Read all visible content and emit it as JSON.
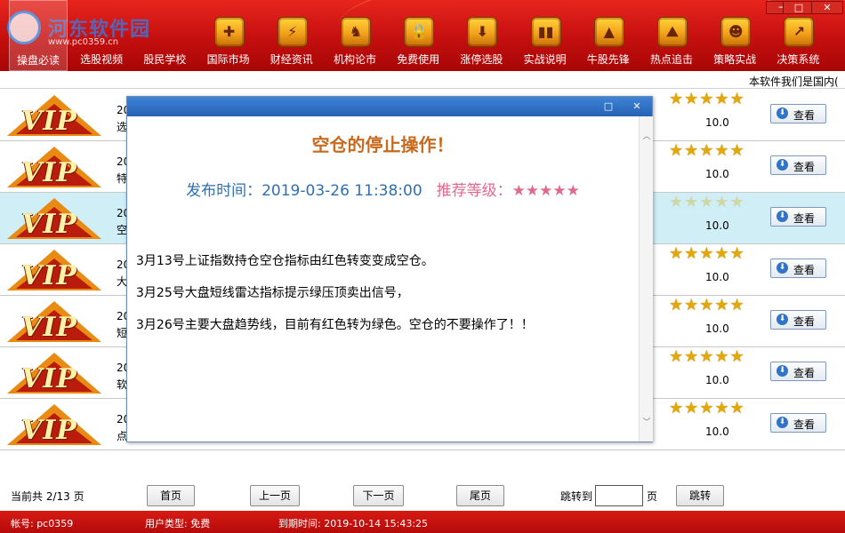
{
  "window": {
    "min_glyph": "─",
    "max_glyph": "□",
    "close_glyph": "✕"
  },
  "logo": {
    "name": "河东软件园",
    "url": "www.pc0359.cn"
  },
  "toolbar": {
    "items": [
      {
        "label": "操盘必读",
        "icon": "book-icon",
        "glyph": ""
      },
      {
        "label": "选股视频",
        "icon": "video-icon",
        "glyph": ""
      },
      {
        "label": "股民学校",
        "icon": "school-icon",
        "glyph": ""
      },
      {
        "label": "国际市场",
        "icon": "puzzle-icon",
        "glyph": "✚"
      },
      {
        "label": "财经资讯",
        "icon": "lightning-shield-icon",
        "glyph": "⚡"
      },
      {
        "label": "机构论市",
        "icon": "horse-icon",
        "glyph": "♞"
      },
      {
        "label": "免费使用",
        "icon": "lock-shield-icon",
        "glyph": "🔒"
      },
      {
        "label": "涨停选股",
        "icon": "down-arrow-shield-icon",
        "glyph": "⬇"
      },
      {
        "label": "实战说明",
        "icon": "bars-chart-icon",
        "glyph": "▮▮"
      },
      {
        "label": "牛股先锋",
        "icon": "flame-icon",
        "glyph": "▲"
      },
      {
        "label": "热点追击",
        "icon": "fire-mountain-icon",
        "glyph": "⛰"
      },
      {
        "label": "策略实战",
        "icon": "person-icon",
        "glyph": "☻"
      },
      {
        "label": "决策系统",
        "icon": "monitor-icon",
        "glyph": "↗"
      }
    ]
  },
  "marquee": "本软件我们是国内(",
  "list": {
    "rows": [
      {
        "date": "20",
        "title": "选",
        "stars": "★★★★★",
        "score": "10.0",
        "view": "查看"
      },
      {
        "date": "20",
        "title": "特",
        "stars": "★★★★★",
        "score": "10.0",
        "view": "查看"
      },
      {
        "date": "20",
        "title": "空",
        "stars": "★★★★★",
        "score": "10.0",
        "view": "查看"
      },
      {
        "date": "20",
        "title": "大",
        "stars": "★★★★★",
        "score": "10.0",
        "view": "查看"
      },
      {
        "date": "20",
        "title": "短",
        "stars": "★★★★★",
        "score": "10.0",
        "view": "查看"
      },
      {
        "date": "20",
        "title": "软",
        "stars": "★★★★★",
        "score": "10.0",
        "view": "查看"
      },
      {
        "date": "20",
        "title": "点",
        "stars": "★★★★★",
        "score": "10.0",
        "view": "查看"
      }
    ],
    "vip_text": "VIP",
    "view_arrow": "⬇"
  },
  "pager": {
    "info": "当前共 2/13 页",
    "first": "首页",
    "prev": "上一页",
    "next": "下一页",
    "last": "尾页",
    "jump_label": "跳转到",
    "jump_value": "",
    "page_unit": "页",
    "jump_button": "跳转"
  },
  "status": {
    "account": "帐号: pc0359",
    "user_type": "用户类型: 免费",
    "expire": "到期时间: 2019-10-14 15:43:25"
  },
  "dialog": {
    "max_glyph": "□",
    "close_glyph": "✕",
    "title": "空仓的停止操作！",
    "publish": "发布时间：2019-03-26 11:38:00",
    "rating": "推荐等级：★★★★★",
    "paragraphs": [
      "3月13号上证指数持仓空仓指标由红色转变变成空仓。",
      "3月25号大盘短线雷达指标提示绿压顶卖出信号，",
      "3月26号主要大盘趋势线，目前有红色转为绿色。空仓的不要操作了！！"
    ]
  }
}
